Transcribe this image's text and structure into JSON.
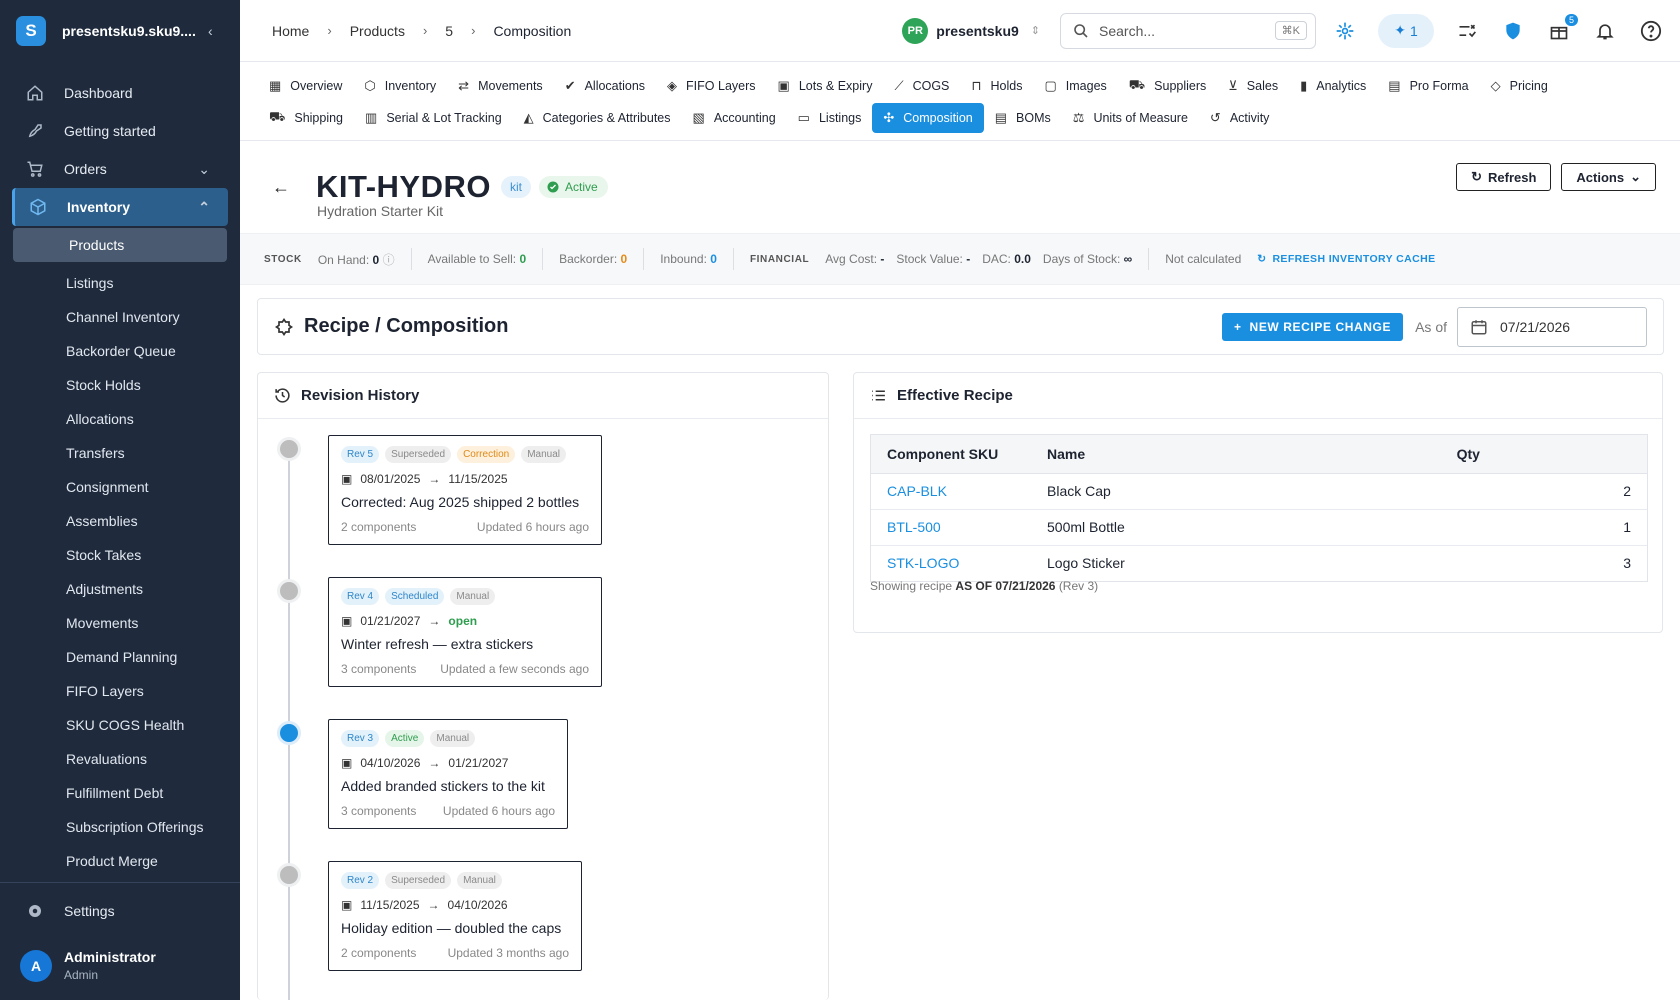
{
  "sidebar": {
    "org": "presentsku9.sku9....",
    "logo_letter": "S",
    "items": [
      {
        "label": "Dashboard",
        "icon": "home-icon"
      },
      {
        "label": "Getting started",
        "icon": "rocket-icon"
      },
      {
        "label": "Orders",
        "icon": "cart-icon"
      },
      {
        "label": "Inventory",
        "icon": "box-icon"
      }
    ],
    "inventory_sub": [
      "Products",
      "Listings",
      "Channel Inventory",
      "Backorder Queue",
      "Stock Holds",
      "Allocations",
      "Transfers",
      "Consignment",
      "Assemblies",
      "Stock Takes",
      "Adjustments",
      "Movements",
      "Demand Planning",
      "FIFO Layers",
      "SKU COGS Health",
      "Revaluations",
      "Fulfillment Debt",
      "Subscription Offerings",
      "Product Merge"
    ],
    "settings": "Settings",
    "user": {
      "initial": "A",
      "name": "Administrator",
      "role": "Admin"
    }
  },
  "topbar": {
    "breadcrumb": [
      "Home",
      "Products",
      "5",
      "Composition"
    ],
    "org_initials": "PR",
    "org_name": "presentsku9",
    "search_placeholder": "Search...",
    "search_shortcut": "⌘K",
    "ai_count": "1",
    "gift_badge": "5"
  },
  "tabs_row1": [
    "Overview",
    "Inventory",
    "Movements",
    "Allocations",
    "FIFO Layers",
    "Lots & Expiry",
    "COGS",
    "Holds",
    "Images",
    "Suppliers",
    "Sales",
    "Analytics",
    "Pro Forma",
    "Pricing"
  ],
  "tabs_row2": [
    "Shipping",
    "Serial & Lot Tracking",
    "Categories & Attributes",
    "Accounting",
    "Listings",
    "Composition",
    "BOMs",
    "Units of Measure",
    "Activity"
  ],
  "product": {
    "sku": "KIT-HYDRO",
    "type_chip": "kit",
    "status": "Active",
    "name": "Hydration Starter Kit",
    "refresh_label": "Refresh",
    "actions_label": "Actions"
  },
  "stats": {
    "stock_label": "STOCK",
    "on_hand_label": "On Hand:",
    "on_hand": "0",
    "available_label": "Available to Sell:",
    "available": "0",
    "backorder_label": "Backorder:",
    "backorder": "0",
    "inbound_label": "Inbound:",
    "inbound": "0",
    "financial_label": "FINANCIAL",
    "avg_cost_label": "Avg Cost:",
    "avg_cost": "-",
    "stock_value_label": "Stock Value:",
    "stock_value": "-",
    "dac_label": "DAC:",
    "dac": "0.0",
    "days_label": "Days of Stock:",
    "days": "∞",
    "not_calc": "Not calculated",
    "refresh_cache": "REFRESH INVENTORY CACHE"
  },
  "recipe": {
    "title": "Recipe / Composition",
    "new_change": "NEW RECIPE CHANGE",
    "as_of_label": "As of",
    "as_of_date": "07/21/2026"
  },
  "history": {
    "title": "Revision History",
    "revisions": [
      {
        "rev": "Rev 5",
        "tags": [
          "Superseded",
          "Correction",
          "Manual"
        ],
        "from": "08/01/2025",
        "to": "11/15/2025",
        "desc": "Corrected: Aug 2025 shipped 2 bottles",
        "components": "2 components",
        "updated": "Updated 6 hours ago"
      },
      {
        "rev": "Rev 4",
        "tags": [
          "Scheduled",
          "Manual"
        ],
        "from": "01/21/2027",
        "to": "open",
        "desc": "Winter refresh — extra stickers",
        "components": "3 components",
        "updated": "Updated a few seconds ago"
      },
      {
        "rev": "Rev 3",
        "tags": [
          "Active",
          "Manual"
        ],
        "from": "04/10/2026",
        "to": "01/21/2027",
        "desc": "Added branded stickers to the kit",
        "components": "3 components",
        "updated": "Updated 6 hours ago"
      },
      {
        "rev": "Rev 2",
        "tags": [
          "Superseded",
          "Manual"
        ],
        "from": "11/15/2025",
        "to": "04/10/2026",
        "desc": "Holiday edition — doubled the caps",
        "components": "2 components",
        "updated": "Updated 3 months ago"
      }
    ]
  },
  "effective": {
    "title": "Effective Recipe",
    "headers": [
      "Component SKU",
      "Name",
      "Qty"
    ],
    "rows": [
      {
        "sku": "CAP-BLK",
        "name": "Black Cap",
        "qty": "2"
      },
      {
        "sku": "BTL-500",
        "name": "500ml Bottle",
        "qty": "1"
      },
      {
        "sku": "STK-LOGO",
        "name": "Logo Sticker",
        "qty": "3"
      }
    ],
    "showing_prefix": "Showing recipe",
    "showing_bold": "AS OF 07/21/2026",
    "showing_suffix": "(Rev 3)"
  }
}
